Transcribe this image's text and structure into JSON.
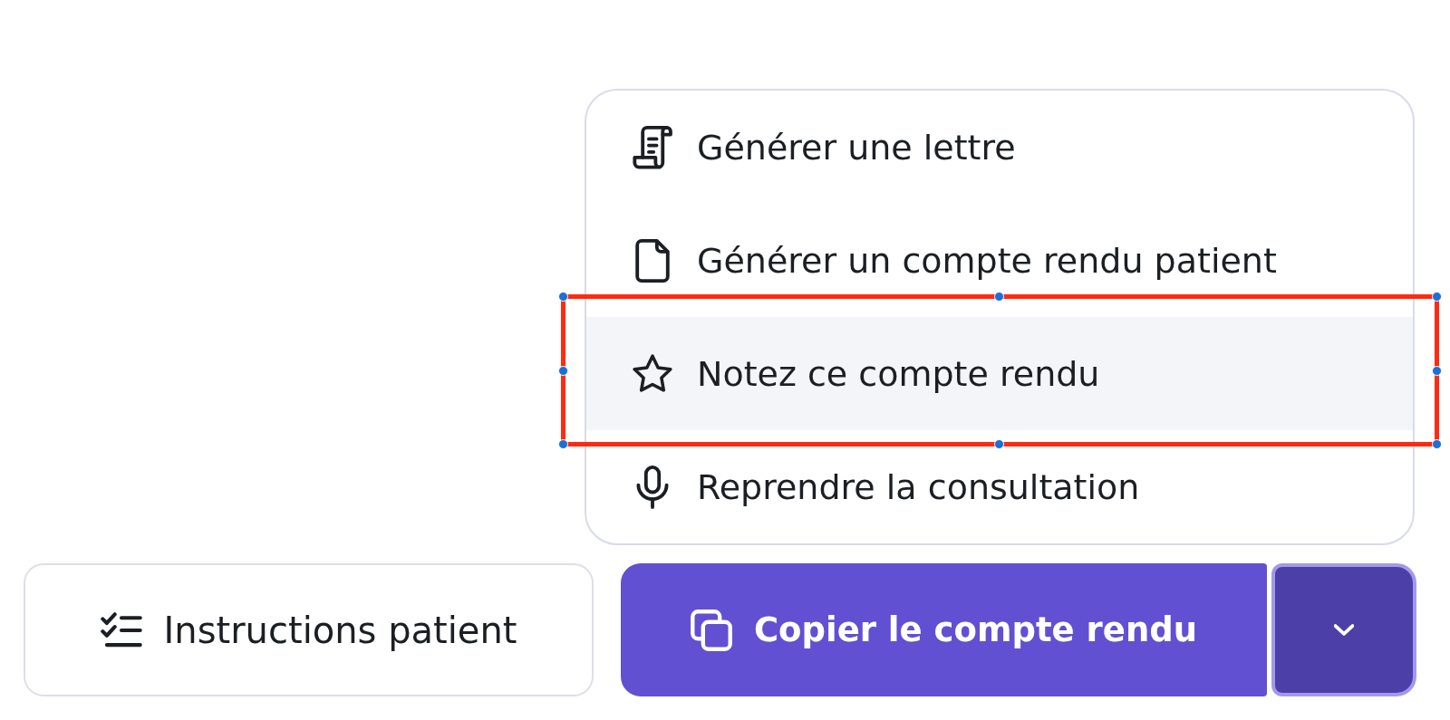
{
  "menu": {
    "items": [
      {
        "kind": "letter",
        "label": "Générer une lettre",
        "selected": false,
        "outlined": false
      },
      {
        "kind": "document",
        "label": "Générer un compte rendu patient",
        "selected": false,
        "outlined": false
      },
      {
        "kind": "star",
        "label": "Notez ce compte rendu",
        "selected": true,
        "outlined": true
      },
      {
        "kind": "microphone",
        "label": "Reprendre la consultation",
        "selected": false,
        "outlined": false
      }
    ]
  },
  "actions": {
    "secondary": {
      "label": "Instructions patient"
    },
    "primary": {
      "label": "Copier le compte rendu"
    },
    "toggle": {
      "expanded": true
    }
  }
}
